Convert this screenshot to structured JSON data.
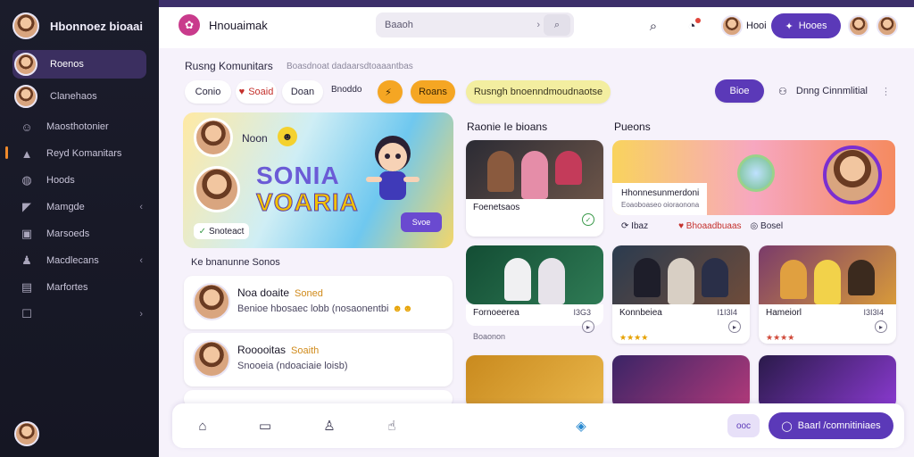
{
  "sidebar": {
    "brand_title": "Hbonnoez bioaai",
    "items": [
      {
        "label": "Roenos",
        "icon": "avatar-icon",
        "active": true
      },
      {
        "label": "Clanehaos",
        "icon": "avatar-icon"
      },
      {
        "label": "Maosthotonier",
        "icon": "smile-icon"
      },
      {
        "label": "Reyd Komanitars",
        "icon": "building-icon"
      },
      {
        "label": "Hoods",
        "icon": "globe-icon"
      },
      {
        "label": "Mamgde",
        "icon": "megaphone-icon"
      },
      {
        "label": "Marsoeds",
        "icon": "box-icon"
      },
      {
        "label": "Macdlecans",
        "icon": "person-icon"
      },
      {
        "label": "Marfortes",
        "icon": "grid-icon"
      },
      {
        "label": "",
        "icon": "square-icon"
      }
    ]
  },
  "header": {
    "title": "Hnouaimak",
    "search_placeholder": "Baaoh",
    "user_name": "Hooi",
    "button_label": "Hooes"
  },
  "main": {
    "title": "Rusng Komunitars",
    "subtitle": "Boasdnoat dadaarsdtoaaantbas",
    "chips": [
      "Conio",
      "Soaid",
      "Doan",
      "Bnoddo",
      "",
      "Roans",
      "Rusngh bnoenndmoudnaotse",
      "Bioe"
    ],
    "right_chip_label": "Dnng Cinnmlitial",
    "hero": {
      "label": "Noon",
      "line1": "SONIA",
      "line2": "VOARIA",
      "tag": "Snoteact",
      "btn": "Svoe"
    },
    "list_title": "Ke bnanunne Sonos",
    "messages": [
      {
        "name": "Noa doaite",
        "tag": "Soned",
        "text": "Benioe hbosaec lobb (nosaonentbi"
      },
      {
        "name": "Rooooitas",
        "tag": "Soaith",
        "text": "Snooeia (ndoaciaie loisb)"
      }
    ]
  },
  "kids_section": {
    "title": "Raonie Ie bioans"
  },
  "pueons_section": {
    "title": "Pueons"
  },
  "cards": [
    {
      "caption": "Foenetsaos",
      "meta": "",
      "sub": ""
    },
    {
      "caption": "Fornoeerea",
      "meta": "I3G3",
      "sub": "Boaonon"
    },
    {
      "caption": "Konnbeiea",
      "meta": "I1I3I4",
      "sub": "★★★★"
    },
    {
      "caption": "Hameiorl",
      "meta": "I3I3I4",
      "sub": "★★★★"
    }
  ],
  "wide_card": {
    "caption": "Hhonnesunmerdoni",
    "sub": "Eoaoboaseo oioraonona",
    "actions": [
      "Ibaz",
      "Bhoaadbuaas",
      "Bosel"
    ]
  },
  "dock": {
    "toggle": "ooc",
    "button_label": "Baarl /comnitiniaes"
  },
  "colors": {
    "accent": "#5b39b8",
    "orange": "#f5a623",
    "sidebar": "#1b1c2b"
  }
}
